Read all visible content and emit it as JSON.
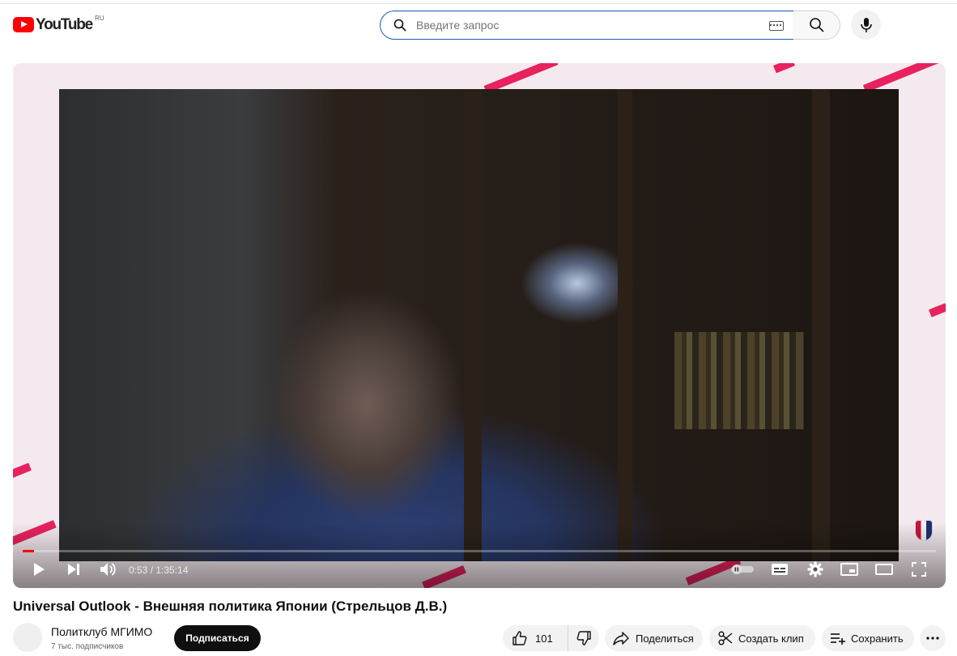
{
  "masthead": {
    "logo_text": "YouTube",
    "country_code": "RU",
    "search_placeholder": "Введите запрос"
  },
  "player": {
    "current_time": "0:53",
    "duration": "1:35:14",
    "time_display": "0:53 / 1:35:14",
    "progress_fraction": 0.0093,
    "accent_color": "#ff0000",
    "frame_stripe_color": "#e8215f"
  },
  "video": {
    "title": "Universal Outlook - Внешняя политика Японии (Стрельцов Д.В.)"
  },
  "channel": {
    "name": "Политклуб МГИМО",
    "subscribers": "7 тыс. подписчиков",
    "subscribe_label": "Подписаться"
  },
  "actions": {
    "like_count": "101",
    "share_label": "Поделиться",
    "clip_label": "Создать клип",
    "save_label": "Сохранить"
  }
}
